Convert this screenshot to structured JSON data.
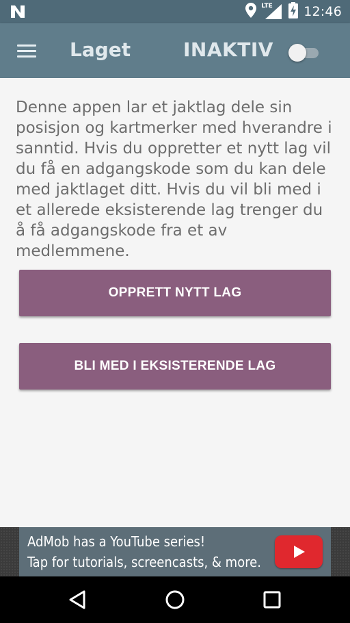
{
  "status_bar": {
    "time": "12:46",
    "network_label": "LTE",
    "icons": [
      "n-icon",
      "location-icon",
      "signal-icon",
      "battery-charging-icon"
    ]
  },
  "app_bar": {
    "title": "Laget",
    "status_label": "INAKTIV",
    "toggle_on": false,
    "menu_icon": "hamburger-menu-icon"
  },
  "main": {
    "intro_text": "Denne appen lar et jaktlag dele sin posisjon og kartmerker med hverandre i sanntid. Hvis du oppretter et nytt lag vil du få en adgangskode som du kan dele med jaktlaget ditt. Hvis du vil bli med i et allerede eksisterende lag trenger du å få adgangskode fra et av medlemmene.",
    "create_button_label": "OPPRETT NYTT LAG",
    "join_button_label": "BLI MED I EKSISTERENDE LAG"
  },
  "ad": {
    "line1": "AdMob has a YouTube series!",
    "line2": "Tap for tutorials, screencasts, & more.",
    "logo_icon": "youtube-play-icon"
  },
  "nav_bar": {
    "icons": [
      "back-icon",
      "home-icon",
      "recent-apps-icon"
    ]
  },
  "colors": {
    "app_bar": "#607d8b",
    "status_bar": "#4f6a78",
    "button": "#8a5e7e",
    "background": "#f5f5f5",
    "ad_banner": "#5d6e78",
    "youtube_red": "#e0282e"
  }
}
